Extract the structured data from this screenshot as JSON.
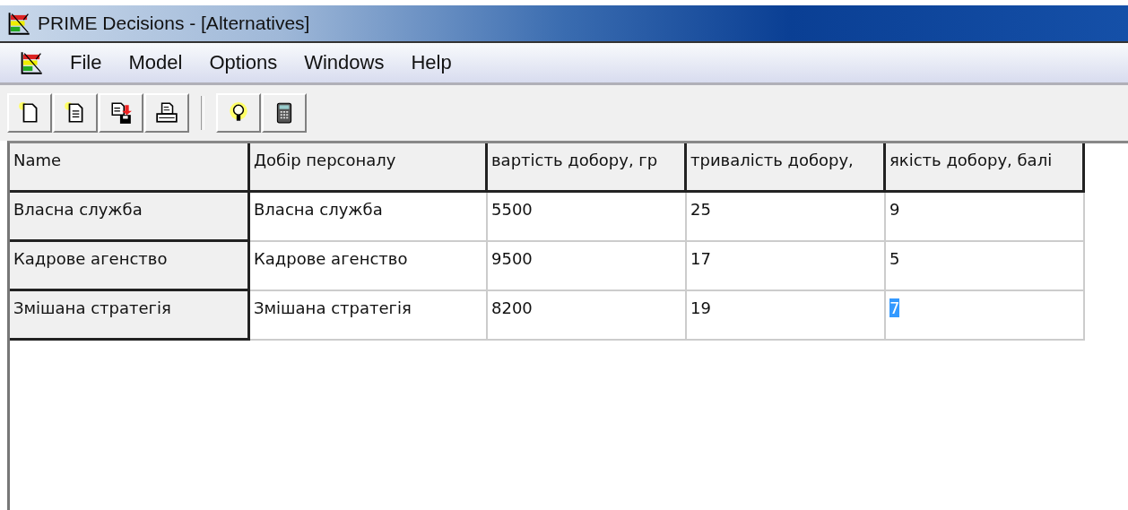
{
  "window": {
    "title": "PRIME Decisions - [Alternatives]"
  },
  "menu": [
    {
      "label": "File"
    },
    {
      "label": "Model"
    },
    {
      "label": "Options"
    },
    {
      "label": "Windows"
    },
    {
      "label": "Help"
    }
  ],
  "toolbar": [
    {
      "kind": "new"
    },
    {
      "kind": "open"
    },
    {
      "kind": "save"
    },
    {
      "kind": "print"
    },
    {
      "kind": "separator"
    },
    {
      "kind": "bulb"
    },
    {
      "kind": "calculator"
    }
  ],
  "table": {
    "columns": [
      "Name",
      "Добір персоналу",
      "вартість добору, гр",
      "тривалість добору,",
      "якість добору, балі"
    ],
    "rows": [
      {
        "cells": [
          {
            "text": "Власна служба",
            "selected": false
          },
          {
            "text": "Власна служба",
            "selected": false
          },
          {
            "text": "5500",
            "selected": false
          },
          {
            "text": "25",
            "selected": false
          },
          {
            "text": "9",
            "selected": false
          }
        ]
      },
      {
        "cells": [
          {
            "text": "Кадрове агенство",
            "selected": false
          },
          {
            "text": "Кадрове агенство",
            "selected": false
          },
          {
            "text": "9500",
            "selected": false
          },
          {
            "text": "17",
            "selected": false
          },
          {
            "text": "5",
            "selected": false
          }
        ]
      },
      {
        "cells": [
          {
            "text": "Змішана стратегія",
            "selected": false
          },
          {
            "text": "Змішана стратегія",
            "selected": false
          },
          {
            "text": "8200",
            "selected": false
          },
          {
            "text": "19",
            "selected": false
          },
          {
            "text": "7",
            "selected": true
          }
        ]
      }
    ]
  }
}
